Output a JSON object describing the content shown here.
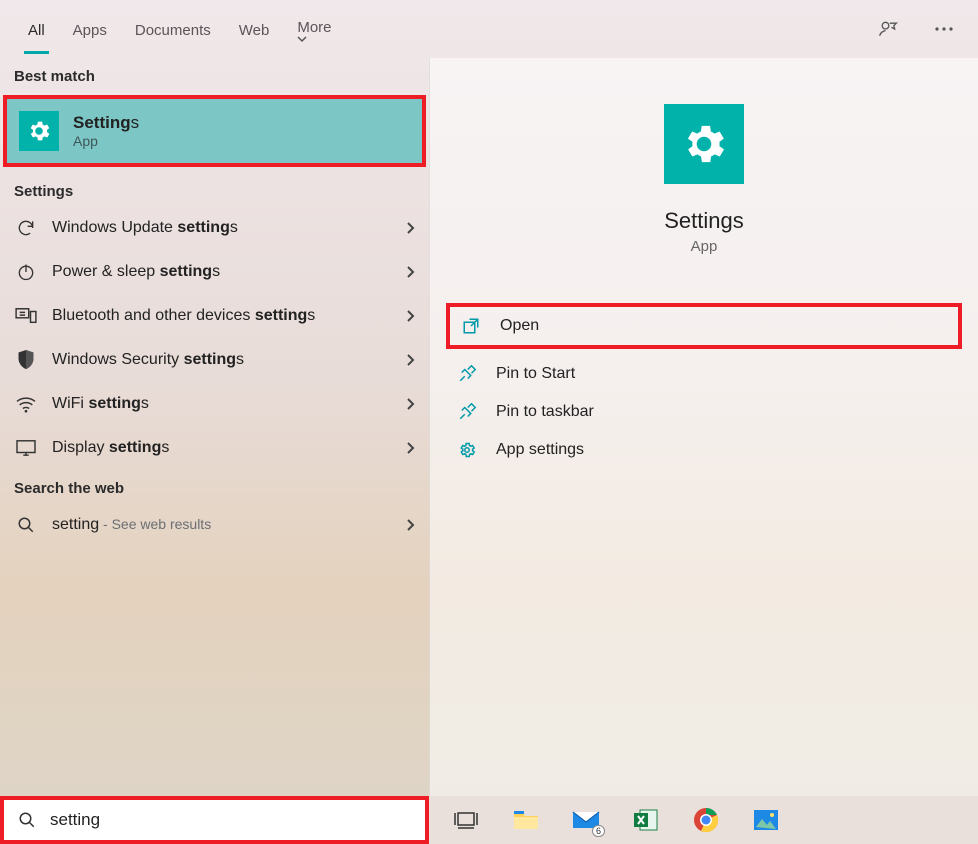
{
  "topbar": {
    "tabs": [
      "All",
      "Apps",
      "Documents",
      "Web",
      "More"
    ],
    "active": "All"
  },
  "left": {
    "best_match_header": "Best match",
    "best_match": {
      "title_bold": "Setting",
      "title_rest": "s",
      "subtitle": "App",
      "icon": "gear-icon"
    },
    "settings_header": "Settings",
    "settings_items": [
      {
        "icon": "sync-icon",
        "pre": "Windows Update ",
        "bold": "setting",
        "post": "s"
      },
      {
        "icon": "power-icon",
        "pre": "Power & sleep ",
        "bold": "setting",
        "post": "s"
      },
      {
        "icon": "devices-icon",
        "pre": "Bluetooth and other devices ",
        "bold": "setting",
        "post": "s"
      },
      {
        "icon": "shield-icon",
        "pre": "Windows Security ",
        "bold": "setting",
        "post": "s"
      },
      {
        "icon": "wifi-icon",
        "pre": "WiFi ",
        "bold": "setting",
        "post": "s"
      },
      {
        "icon": "display-icon",
        "pre": "Display ",
        "bold": "setting",
        "post": "s"
      }
    ],
    "web_header": "Search the web",
    "web_item": {
      "query": "setting",
      "hint": " - See web results"
    }
  },
  "right": {
    "title": "Settings",
    "subtitle": "App",
    "actions": [
      {
        "icon": "open-icon",
        "label": "Open",
        "highlight": true
      },
      {
        "icon": "pin-icon",
        "label": "Pin to Start",
        "highlight": false
      },
      {
        "icon": "pin-icon",
        "label": "Pin to taskbar",
        "highlight": false
      },
      {
        "icon": "gear-outline-icon",
        "label": "App settings",
        "highlight": false
      }
    ]
  },
  "taskbar": {
    "search_value": "setting",
    "mail_badge": "6"
  }
}
